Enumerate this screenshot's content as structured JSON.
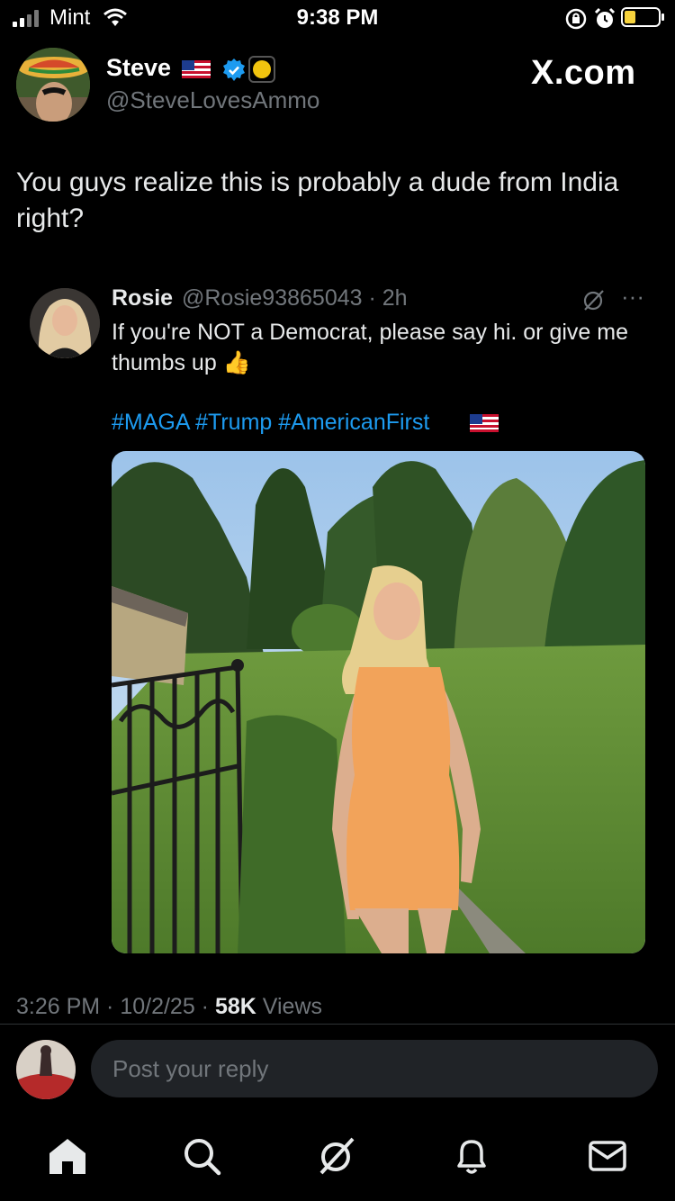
{
  "status_bar": {
    "carrier": "Mint",
    "time": "9:38 PM",
    "icons": [
      "signal-icon",
      "wifi-icon",
      "orientation-lock-icon",
      "alarm-icon",
      "battery-icon"
    ]
  },
  "tweet": {
    "author_name": "Steve",
    "author_handle": "@SteveLovesAmmo",
    "badges": [
      "us-flag-icon",
      "verified-icon",
      "gold-badge-icon"
    ],
    "brand": "X.com",
    "text": "You guys realize this is probably a dude from India right?",
    "timestamp": "3:26 PM · 10/2/25 · ",
    "views_count": "58K",
    "views_label": " Views"
  },
  "quoted_tweet": {
    "author_name": "Rosie",
    "author_handle": "@Rosie93865043 · 2h",
    "text": "If you're NOT a Democrat, please say hi. or give me thumbs up 👍",
    "hashtags": "#MAGA #Trump #AmericanFirst",
    "icons": [
      "grok-icon",
      "more-icon",
      "us-flag-icon",
      "thumbs-up-icon"
    ]
  },
  "reply": {
    "placeholder": "Post your reply"
  },
  "tab_bar": {
    "items": [
      "home-icon",
      "search-icon",
      "grok-icon",
      "notifications-icon",
      "messages-icon"
    ]
  },
  "colors": {
    "background": "#000000",
    "primary_text": "#e7e9ea",
    "secondary_text": "#71767b",
    "link": "#1d9bf0",
    "verified": "#1d9bf0",
    "input_bg": "#202327"
  }
}
